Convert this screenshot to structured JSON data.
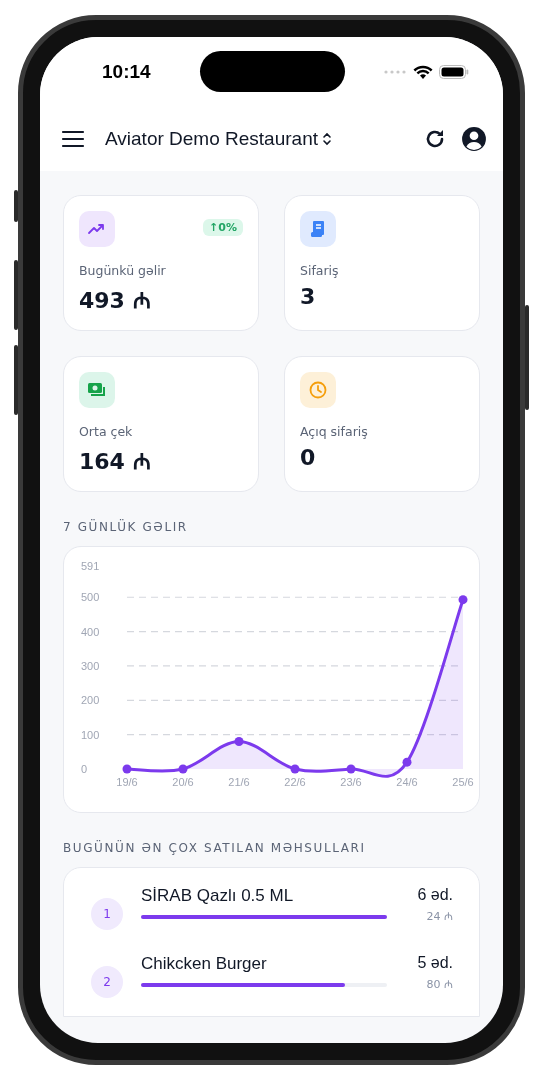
{
  "status_bar": {
    "time": "10:14"
  },
  "header": {
    "title": "Aviator Demo Restaurant"
  },
  "stats": [
    {
      "kind": "revenue",
      "label": "Bugünkü gəlir",
      "value": "493 ₼",
      "badge": "↑0%"
    },
    {
      "kind": "orders",
      "label": "Sifariş",
      "value": "3"
    },
    {
      "kind": "average",
      "label": "Orta çek",
      "value": "164 ₼"
    },
    {
      "kind": "open",
      "label": "Açıq sifariş",
      "value": "0"
    }
  ],
  "revenue_section": {
    "title": "7 GÜNLÜK GƏLIR",
    "chart_data": {
      "type": "area",
      "categories": [
        "19/6",
        "20/6",
        "21/6",
        "22/6",
        "23/6",
        "24/6",
        "25/6"
      ],
      "grid": true,
      "series": [
        {
          "color": "#7c3aed",
          "values": [
            0,
            0,
            80,
            0,
            0,
            20,
            493
          ]
        }
      ],
      "ylim": [
        0,
        591
      ],
      "yticks": [
        0,
        100,
        200,
        300,
        400,
        500,
        591
      ]
    }
  },
  "products_section": {
    "title": "BUGÜNÜN ƏN ÇOX SATILAN MƏHSULLARI",
    "items": [
      {
        "rank": "1",
        "name": "SİRAB Qazlı 0.5 ML",
        "level": 1,
        "quantity": "6 əd.",
        "amount": "24 ₼"
      },
      {
        "rank": "2",
        "name": "Chikcken Burger",
        "level": 0.83,
        "quantity": "5 əd.",
        "amount": "80 ₼"
      }
    ]
  }
}
